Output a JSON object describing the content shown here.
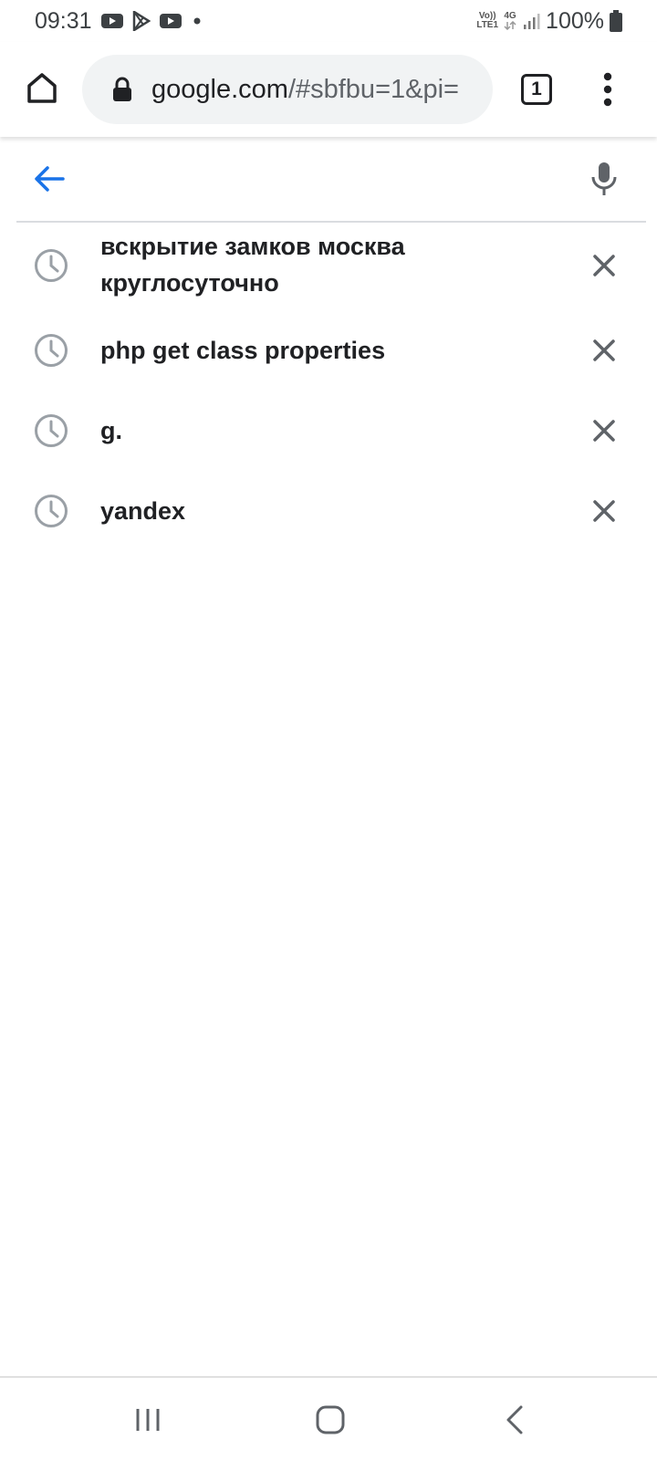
{
  "status_bar": {
    "time": "09:31",
    "notification_icons": [
      "youtube-icon",
      "play-store-icon",
      "youtube-icon",
      "dot-icon"
    ],
    "volte_label": "Vo))",
    "lte_label": "LTE1",
    "network_label": "4G",
    "battery_text": "100%"
  },
  "chrome": {
    "url_host": "google.com",
    "url_path": "/#sbfbu=1&pi=",
    "tab_count": "1"
  },
  "search": {
    "value": "",
    "placeholder": ""
  },
  "suggestions": [
    {
      "text": "вскрытие замков москва круглосуточно",
      "type": "history"
    },
    {
      "text": "php get class properties",
      "type": "history"
    },
    {
      "text": "g.",
      "type": "history"
    },
    {
      "text": "yandex",
      "type": "history"
    }
  ],
  "colors": {
    "accent": "#1a73e8",
    "icon_gray": "#5f6368",
    "clock_gray": "#9aa0a6",
    "url_pill": "#f1f3f4"
  },
  "nav_bar": {
    "buttons": [
      "recent-apps-icon",
      "home-icon",
      "back-icon"
    ]
  }
}
